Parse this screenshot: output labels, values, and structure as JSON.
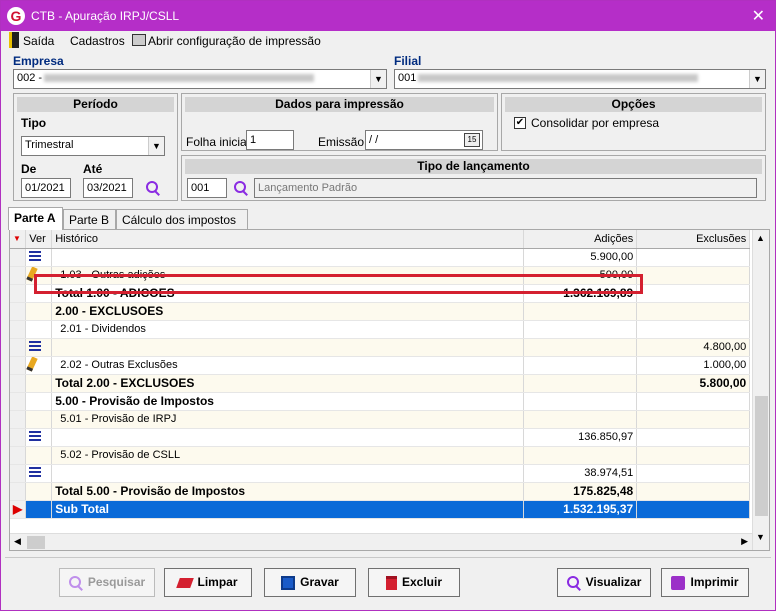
{
  "window": {
    "title": "CTB - Apuração IRPJ/CSLL",
    "close_glyph": "✕",
    "app_icon_letter": "G"
  },
  "menu": [
    {
      "label": "Saída",
      "icon": "exit-icon"
    },
    {
      "label": "Cadastros",
      "icon": ""
    },
    {
      "label": "Abrir configuração de impressão",
      "icon": "printer-icon"
    }
  ],
  "empresa": {
    "label": "Empresa",
    "value": "002 -"
  },
  "filial": {
    "label": "Filial",
    "value": "001"
  },
  "periodo": {
    "header": "Período",
    "tipo_label": "Tipo",
    "tipo_value": "Trimestral",
    "de_label": "De",
    "de_value": "01/2021",
    "ate_label": "Até",
    "ate_value": "03/2021"
  },
  "dados_impressao": {
    "header": "Dados para impressão",
    "folha_label": "Folha inicial",
    "folha_value": "1",
    "emissao_label": "Emissão",
    "emissao_value": " / /",
    "calendar_glyph": "15"
  },
  "opcoes": {
    "header": "Opções",
    "consolidar_label": "Consolidar por empresa",
    "consolidar_checked": true
  },
  "tipo_lancamento": {
    "header": "Tipo de lançamento",
    "code": "001",
    "description": "Lançamento Padrão"
  },
  "tabs": [
    "Parte A",
    "Parte B",
    "Cálculo dos impostos"
  ],
  "grid": {
    "columns": [
      "Ver",
      "Histórico",
      "Adições",
      "Exclusões"
    ],
    "rows": [
      {
        "icon": "list",
        "historico": "",
        "adicoes": "5.900,00",
        "exclusoes": "",
        "style": ""
      },
      {
        "icon": "pencil",
        "historico": "1.03 - Outras adições",
        "adicoes": "500,00",
        "exclusoes": "",
        "style": "alt"
      },
      {
        "icon": "",
        "historico": "Total 1.00 - ADICOES",
        "adicoes": "1.362.169,89",
        "exclusoes": "",
        "style": "bold"
      },
      {
        "icon": "",
        "historico": "2.00 - EXCLUSOES",
        "adicoes": "",
        "exclusoes": "",
        "style": "bold alt"
      },
      {
        "icon": "",
        "historico": "2.01 - Dividendos",
        "adicoes": "",
        "exclusoes": "",
        "style": ""
      },
      {
        "icon": "list",
        "historico": "",
        "adicoes": "",
        "exclusoes": "4.800,00",
        "style": "alt"
      },
      {
        "icon": "pencil",
        "historico": "2.02 - Outras Exclusões",
        "adicoes": "",
        "exclusoes": "1.000,00",
        "style": ""
      },
      {
        "icon": "",
        "historico": "Total 2.00 - EXCLUSOES",
        "adicoes": "",
        "exclusoes": "5.800,00",
        "style": "bold alt"
      },
      {
        "icon": "",
        "historico": "5.00 - Provisão de Impostos",
        "adicoes": "",
        "exclusoes": "",
        "style": "bold"
      },
      {
        "icon": "",
        "historico": "5.01 - Provisão de IRPJ",
        "adicoes": "",
        "exclusoes": "",
        "style": "alt"
      },
      {
        "icon": "list",
        "historico": "",
        "adicoes": "136.850,97",
        "exclusoes": "",
        "style": ""
      },
      {
        "icon": "",
        "historico": "5.02 - Provisão de CSLL",
        "adicoes": "",
        "exclusoes": "",
        "style": "alt"
      },
      {
        "icon": "list",
        "historico": "",
        "adicoes": "38.974,51",
        "exclusoes": "",
        "style": ""
      },
      {
        "icon": "",
        "historico": "Total 5.00 - Provisão de Impostos",
        "adicoes": "175.825,48",
        "exclusoes": "",
        "style": "bold alt"
      },
      {
        "icon": "",
        "historico": "Sub Total",
        "adicoes": "1.532.195,37",
        "exclusoes": "",
        "style": "sel"
      }
    ]
  },
  "buttons": [
    {
      "label": "Pesquisar",
      "icon": "search-icon",
      "enabled": false
    },
    {
      "label": "Limpar",
      "icon": "eraser-icon",
      "enabled": true
    },
    {
      "label": "Gravar",
      "icon": "save-icon",
      "enabled": true
    },
    {
      "label": "Excluir",
      "icon": "trash-icon",
      "enabled": true
    },
    {
      "label": "Visualizar",
      "icon": "search-icon",
      "enabled": true
    },
    {
      "label": "Imprimir",
      "icon": "printer-icon",
      "enabled": true
    }
  ],
  "colors": {
    "title_bar": "#b52ec8",
    "selection": "#0a6ad8",
    "highlight_border": "#d42030",
    "label_blue": "#002b7f"
  }
}
